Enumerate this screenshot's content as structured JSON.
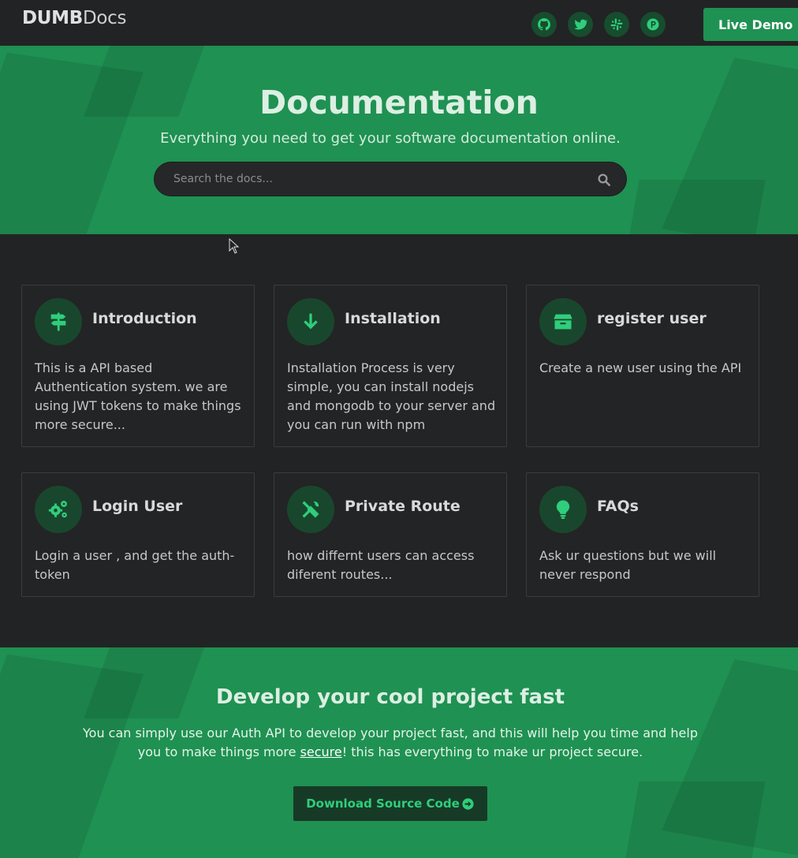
{
  "header": {
    "logo_bold": "DUMB",
    "logo_light": "Docs",
    "social": [
      {
        "icon": "github-icon"
      },
      {
        "icon": "twitter-icon"
      },
      {
        "icon": "slack-icon"
      },
      {
        "icon": "product-hunt-icon"
      }
    ],
    "demo_label": "Live Demo"
  },
  "hero": {
    "title": "Documentation",
    "subtitle": "Everything you need to get your software documentation online.",
    "search_placeholder": "Search the docs..."
  },
  "cards": [
    {
      "icon": "signpost-icon",
      "title": "Introduction",
      "description": "This is a API based Authentication system. we are using JWT tokens to make things more secure..."
    },
    {
      "icon": "arrow-down-icon",
      "title": "Installation",
      "description": "Installation Process is very simple, you can install nodejs and mongodb to your server and you can run with npm"
    },
    {
      "icon": "box-icon",
      "title": "register user",
      "description": "Create a new user using the API"
    },
    {
      "icon": "cogs-icon",
      "title": "Login User",
      "description": "Login a user , and get the auth-token"
    },
    {
      "icon": "tools-icon",
      "title": "Private Route",
      "description": "how differnt users can access diferent routes..."
    },
    {
      "icon": "lightbulb-icon",
      "title": "FAQs",
      "description": "Ask ur questions but we will never respond"
    }
  ],
  "cta": {
    "title": "Develop your cool project fast",
    "text_before": "You can simply use our Auth API to develop your project fast, and this will help you time and help you to make things more ",
    "link_text": "secure",
    "text_after": "! this has everything to make ur project secure.",
    "button_label": "Download Source Code"
  },
  "colors": {
    "primary_green": "#1f9152",
    "accent_green": "#2fce7c",
    "background": "#222324"
  }
}
